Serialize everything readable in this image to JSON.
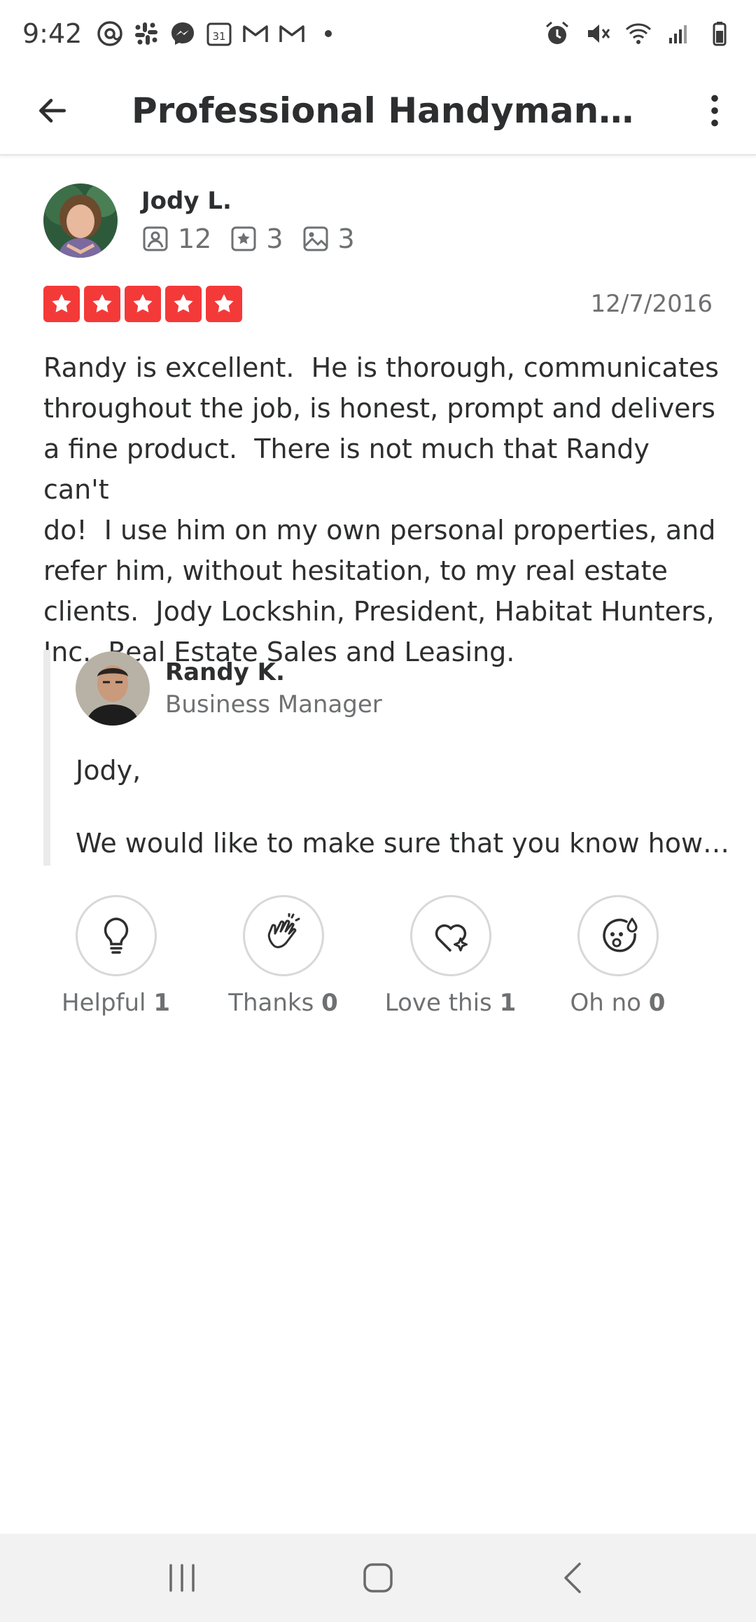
{
  "status_bar": {
    "time": "9:42",
    "left_icons": [
      "threads-icon",
      "slack-icon",
      "messenger-icon",
      "calendar-icon",
      "gmail-icon",
      "gmail-icon",
      "dot-icon"
    ],
    "calendar_day": "31",
    "right_icons": [
      "alarm-icon",
      "mute-icon",
      "wifi-icon",
      "signal-icon",
      "battery-icon"
    ]
  },
  "app_bar": {
    "title": "Professional Handyman…"
  },
  "review": {
    "reviewer_name": "Jody L.",
    "stats": {
      "friends": "12",
      "reviews": "3",
      "photos": "3"
    },
    "rating": 5,
    "date": "12/7/2016",
    "text": "Randy is excellent.  He is thorough, communicates\nthroughout the job, is honest, prompt and delivers\na fine product.  There is not much that Randy can't\ndo!  I use him on my own personal properties, and\nrefer him, without hesitation, to my real estate\nclients.  Jody Lockshin, President, Habitat Hunters,\nInc., Real Estate Sales and Leasing."
  },
  "reply": {
    "name": "Randy K.",
    "role": "Business Manager",
    "greeting": "Jody,",
    "body": "We would like to make sure that you know how…"
  },
  "reactions": [
    {
      "label": "Helpful",
      "count": "1",
      "icon": "lightbulb-icon"
    },
    {
      "label": "Thanks",
      "count": "0",
      "icon": "clapping-hands-icon"
    },
    {
      "label": "Love this",
      "count": "1",
      "icon": "heart-sparkle-icon"
    },
    {
      "label": "Oh no",
      "count": "0",
      "icon": "surprised-face-icon"
    }
  ],
  "colors": {
    "star_red": "#f43939",
    "text_dark": "#2d2e2f",
    "text_gray": "#6e7072",
    "reply_bar": "#ebebeb",
    "nav_bg": "#f2f2f2"
  }
}
